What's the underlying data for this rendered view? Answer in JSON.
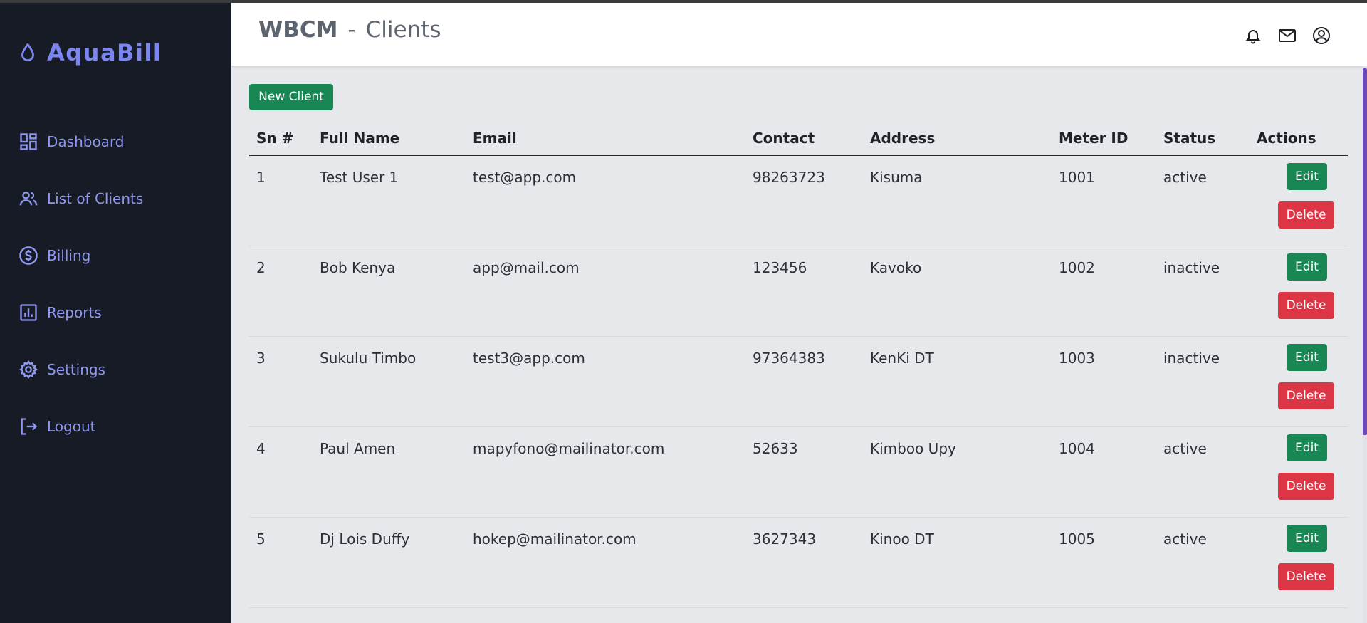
{
  "app": {
    "name": "AquaBill",
    "org": "WBCM",
    "page": "Clients",
    "separator": "-"
  },
  "sidebar": {
    "items": [
      {
        "label": "Dashboard",
        "icon": "dashboard-icon"
      },
      {
        "label": "List of Clients",
        "icon": "users-icon"
      },
      {
        "label": "Billing",
        "icon": "dollar-icon"
      },
      {
        "label": "Reports",
        "icon": "bar-chart-icon"
      },
      {
        "label": "Settings",
        "icon": "gear-icon"
      },
      {
        "label": "Logout",
        "icon": "logout-icon"
      }
    ]
  },
  "header": {
    "icons": [
      "bell-icon",
      "mail-icon",
      "user-circle-icon"
    ]
  },
  "toolbar": {
    "new_client_label": "New Client"
  },
  "table": {
    "columns": [
      "Sn #",
      "Full Name",
      "Email",
      "Contact",
      "Address",
      "Meter ID",
      "Status",
      "Actions"
    ],
    "edit_label": "Edit",
    "delete_label": "Delete",
    "rows": [
      {
        "sn": "1",
        "name": "Test User 1",
        "email": "test@app.com",
        "contact": "98263723",
        "address": "Kisuma",
        "meter": "1001",
        "status": "active"
      },
      {
        "sn": "2",
        "name": "Bob Kenya",
        "email": "app@mail.com",
        "contact": "123456",
        "address": "Kavoko",
        "meter": "1002",
        "status": "inactive"
      },
      {
        "sn": "3",
        "name": "Sukulu Timbo",
        "email": "test3@app.com",
        "contact": "97364383",
        "address": "KenKi DT",
        "meter": "1003",
        "status": "inactive"
      },
      {
        "sn": "4",
        "name": "Paul Amen",
        "email": "mapyfono@mailinator.com",
        "contact": "52633",
        "address": "Kimboo Upy",
        "meter": "1004",
        "status": "active"
      },
      {
        "sn": "5",
        "name": "Dj Lois Duffy",
        "email": "hokep@mailinator.com",
        "contact": "3627343",
        "address": "Kinoo DT",
        "meter": "1005",
        "status": "active"
      }
    ]
  },
  "colors": {
    "sidebar_bg": "#161b26",
    "accent": "#7b86f2",
    "success": "#198754",
    "danger": "#dc3545",
    "content_bg": "#e7e8ec"
  }
}
